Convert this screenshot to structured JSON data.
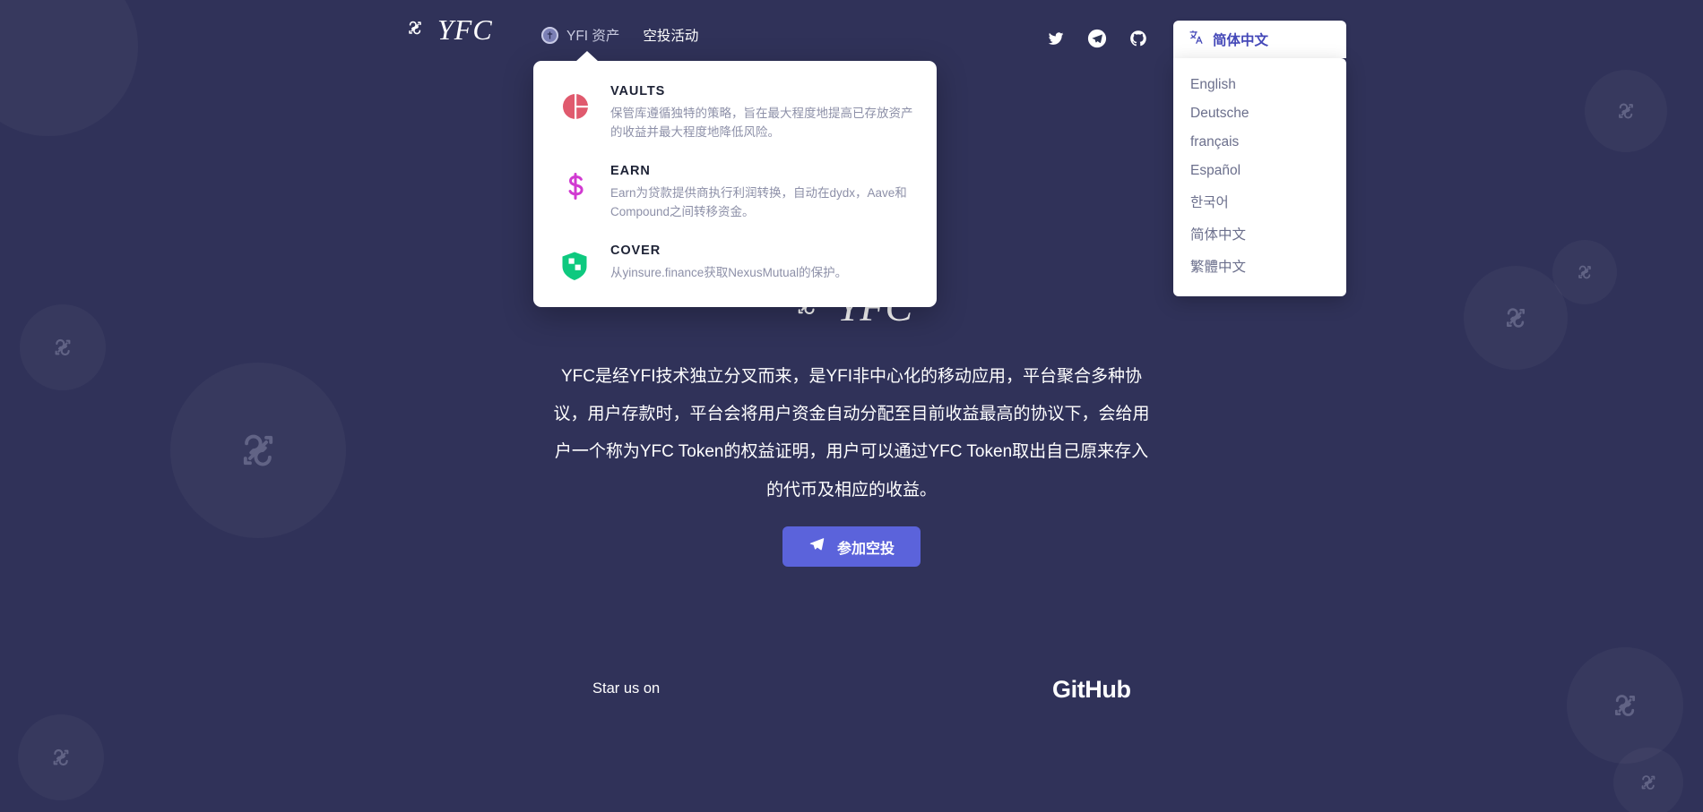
{
  "brand": {
    "logo_icon": "yfc-swap-logo-icon",
    "name": "YFC"
  },
  "nav": {
    "items": [
      {
        "label": "YFI 资产",
        "icon": "yfi-coin-icon",
        "has_dropdown": true
      },
      {
        "label": "空投活动",
        "icon": "",
        "has_dropdown": false
      }
    ]
  },
  "socials": [
    {
      "name": "twitter-icon",
      "label": "Twitter"
    },
    {
      "name": "telegram-icon",
      "label": "Telegram"
    },
    {
      "name": "github-icon",
      "label": "GitHub"
    }
  ],
  "language": {
    "selected": "简体中文",
    "icon": "translate-icon",
    "options": [
      "English",
      "Deutsche",
      "français",
      "Español",
      "한국어",
      "简体中文",
      "繁體中文"
    ]
  },
  "mega_menu": {
    "items": [
      {
        "title": "VAULTS",
        "desc": "保管库遵循独特的策略，旨在最大程度地提高已存放资产的收益并最大程度地降低风险。",
        "icon": "vaults-icon",
        "color": "#e05a6e"
      },
      {
        "title": "EARN",
        "desc": "Earn为贷款提供商执行利润转换，自动在dydx，Aave和Compound之间转移资金。",
        "icon": "earn-dollar-icon",
        "color": "#d13ad1"
      },
      {
        "title": "COVER",
        "desc": "从yinsure.finance获取NexusMutual的保护。",
        "icon": "cover-shield-icon",
        "color": "#0ec97f"
      }
    ]
  },
  "hero": {
    "logo_text": "YFC",
    "logo_icon": "yfc-swap-logo-icon",
    "paragraph": "YFC是经YFI技术独立分叉而来，是YFI非中心化的移动应用，平台聚合多种协议，用户存款时，平台会将用户资金自动分配至目前收益最高的协议下，会给用户一个称为YFC Token的权益证明，用户可以通过YFC Token取出自己原来存入的代币及相应的收益。",
    "cta_label": "参加空投",
    "cta_icon": "send-plane-icon",
    "cta_color": "#5b63db"
  },
  "footer": {
    "star_label": "Star us on",
    "github_label": "GitHub",
    "github_icon": "github-mark-icon"
  },
  "theme": {
    "background": "#303259",
    "panel": "#ffffff",
    "accent": "#4448b8"
  }
}
